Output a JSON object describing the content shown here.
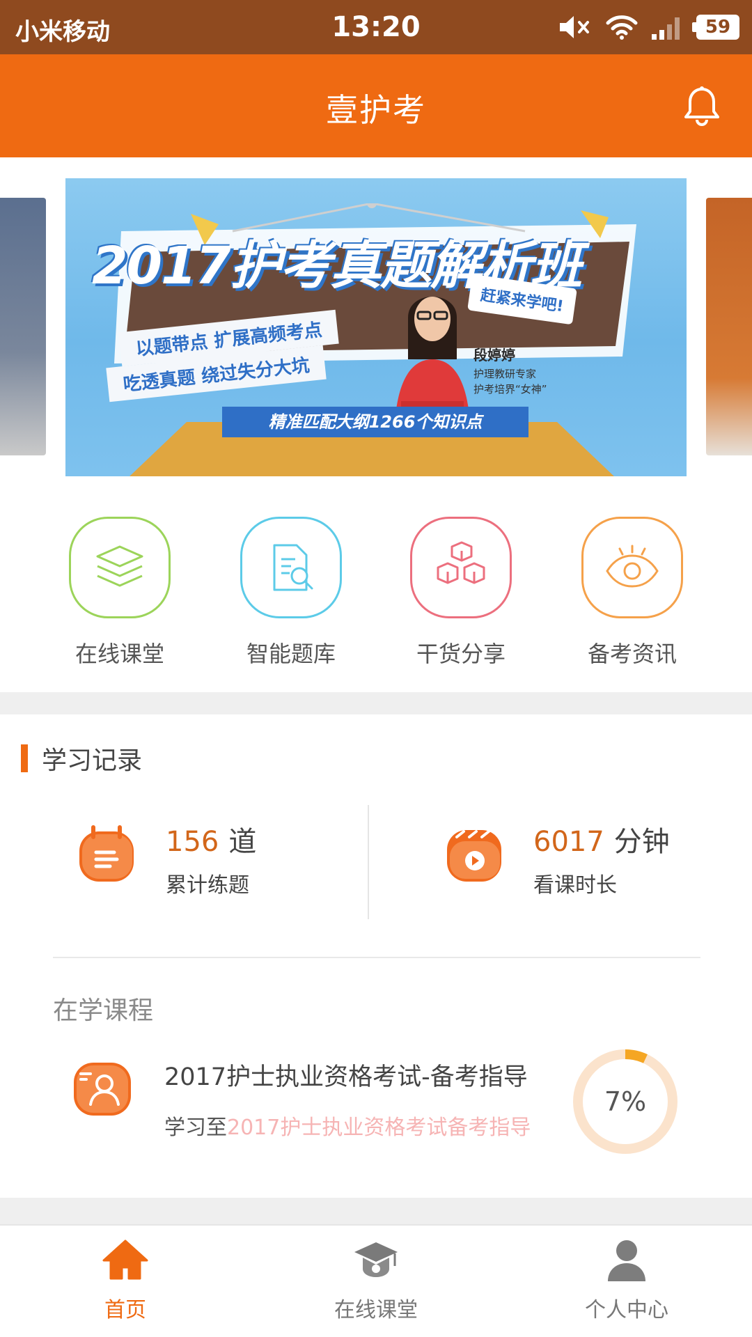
{
  "status_bar": {
    "carrier": "小米移动",
    "time": "13:20",
    "battery": "59",
    "icons": [
      "mute-icon",
      "wifi-icon",
      "signal-icon",
      "battery-icon"
    ]
  },
  "header": {
    "title": "壹护考",
    "bell_icon": "bell-icon"
  },
  "banner": {
    "title": "2017护考真题解析班",
    "ribbon_1": "以题带点  扩展高频考点",
    "ribbon_2": "吃透真题  绕过失分大坑",
    "bubble": "赶紧来学吧!",
    "teacher_name": "段婷婷",
    "teacher_line_1": "护理教研专家",
    "teacher_line_2": "护考培界“女神”",
    "stage_label": "精准匹配大纲1266个知识点"
  },
  "categories": [
    {
      "label": "在线课堂",
      "icon": "layers-icon",
      "color": "#9cd45a"
    },
    {
      "label": "智能题库",
      "icon": "document-search-icon",
      "color": "#5ccbe8"
    },
    {
      "label": "干货分享",
      "icon": "boxes-icon",
      "color": "#ec6f7e"
    },
    {
      "label": "备考资讯",
      "icon": "eye-icon",
      "color": "#f5a14a"
    }
  ],
  "record": {
    "title": "学习记录",
    "practice": {
      "value": "156",
      "unit": "道",
      "label": "累计练题"
    },
    "watch": {
      "value": "6017",
      "unit": "分钟",
      "label": "看课时长"
    },
    "current_title": "在学课程",
    "course": {
      "name": "2017护士执业资格考试-备考指导",
      "progress_prefix": "学习至",
      "progress_lesson": "2017护士执业资格考试备考指导",
      "percent_text": "7%",
      "percent": 0.07
    }
  },
  "bottom_nav": [
    {
      "label": "首页",
      "icon": "home-icon",
      "active": true
    },
    {
      "label": "在线课堂",
      "icon": "graduation-cap-icon",
      "active": false
    },
    {
      "label": "个人中心",
      "icon": "user-icon",
      "active": false
    }
  ],
  "colors": {
    "primary": "#ef6a12",
    "status_bar": "#8f4a1f",
    "accent_number": "#d2661a",
    "progress_track": "#fbe3cc",
    "progress_fill": "#f5a623"
  }
}
